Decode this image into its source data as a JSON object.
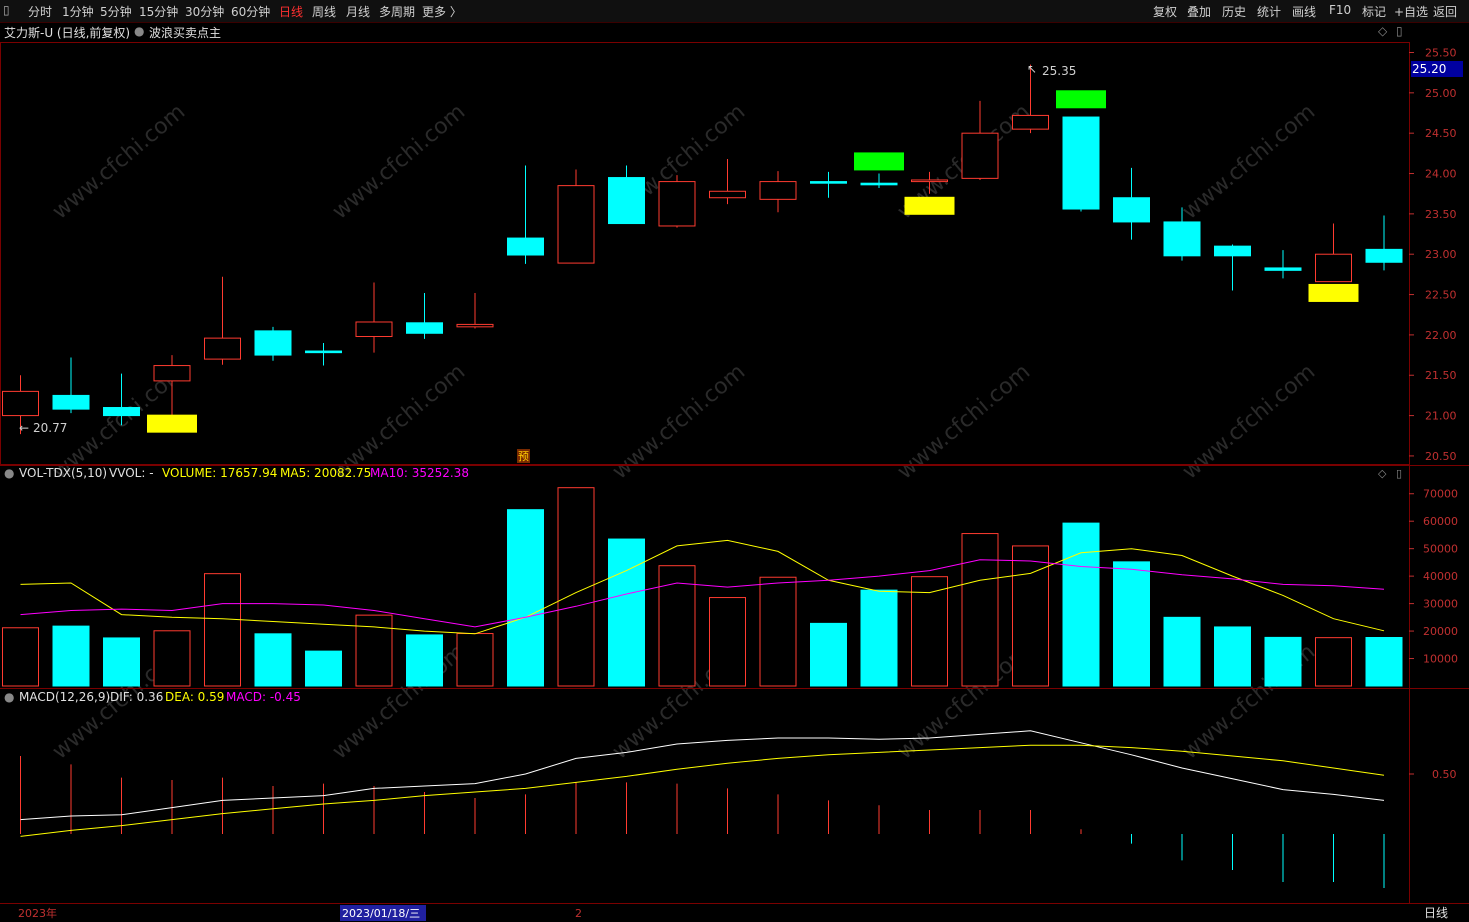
{
  "toolbar": {
    "left": [
      "分时",
      "1分钟",
      "5分钟",
      "15分钟",
      "30分钟",
      "60分钟",
      "日线",
      "周线",
      "月线",
      "多周期",
      "更多 〉"
    ],
    "active": "日线",
    "right": [
      "复权",
      "叠加",
      "历史",
      "统计",
      "画线",
      "F10",
      "标记",
      "+自选",
      "返回"
    ]
  },
  "chart_title": {
    "stock": "艾力斯-U (日线,前复权)",
    "indicator": "波浪买卖点主"
  },
  "price_panel": {
    "current_price": "25.20",
    "high_label": "25.35",
    "low_label": "20.77",
    "pre_marker": "预",
    "y_ticks": [
      "25.50",
      "25.00",
      "24.50",
      "24.00",
      "23.50",
      "23.00",
      "22.50",
      "22.00",
      "21.50",
      "21.00",
      "20.50"
    ]
  },
  "volume_panel": {
    "title": "VOL-TDX(5,10)",
    "vvol": "VVOL: -",
    "volume": "VOLUME: 17657.94",
    "ma5": "MA5: 20082.75",
    "ma10": "MA10: 35252.38",
    "y_ticks": [
      "70000",
      "60000",
      "50000",
      "40000",
      "30000",
      "20000",
      "10000"
    ]
  },
  "macd_panel": {
    "title": "MACD(12,26,9)",
    "dif": "DIF: 0.36",
    "dea": "DEA: 0.59",
    "macd": "MACD: -0.45",
    "y_tick": "0.50"
  },
  "bottom": {
    "year": "2023年",
    "date": "2023/01/18/三",
    "month": "2",
    "period": "日线"
  },
  "colors": {
    "up": "#ff3b30",
    "down": "#00ffff",
    "ma5": "#ffff00",
    "ma10": "#ff00ff",
    "buy": "#ffff00",
    "sell": "#00ff00"
  },
  "chart_data": {
    "type": "candlestick",
    "candles": [
      {
        "o": 21.0,
        "h": 21.5,
        "l": 20.77,
        "c": 21.3
      },
      {
        "o": 21.25,
        "h": 21.72,
        "l": 21.03,
        "c": 21.08
      },
      {
        "o": 21.1,
        "h": 21.52,
        "l": 20.88,
        "c": 21.0
      },
      {
        "o": 21.43,
        "h": 21.75,
        "l": 20.8,
        "c": 21.62
      },
      {
        "o": 21.7,
        "h": 22.72,
        "l": 21.63,
        "c": 21.96
      },
      {
        "o": 22.05,
        "h": 22.1,
        "l": 21.68,
        "c": 21.75
      },
      {
        "o": 21.8,
        "h": 21.9,
        "l": 21.62,
        "c": 21.78
      },
      {
        "o": 21.98,
        "h": 22.65,
        "l": 21.78,
        "c": 22.16
      },
      {
        "o": 22.15,
        "h": 22.52,
        "l": 21.95,
        "c": 22.02
      },
      {
        "o": 22.1,
        "h": 22.52,
        "l": 22.08,
        "c": 22.13
      },
      {
        "o": 23.2,
        "h": 24.1,
        "l": 22.88,
        "c": 22.99
      },
      {
        "o": 22.89,
        "h": 24.05,
        "l": 22.89,
        "c": 23.85
      },
      {
        "o": 23.95,
        "h": 24.1,
        "l": 23.38,
        "c": 23.38
      },
      {
        "o": 23.35,
        "h": 23.98,
        "l": 23.33,
        "c": 23.9
      },
      {
        "o": 23.7,
        "h": 24.18,
        "l": 23.62,
        "c": 23.78
      },
      {
        "o": 23.68,
        "h": 24.03,
        "l": 23.52,
        "c": 23.9
      },
      {
        "o": 23.9,
        "h": 24.02,
        "l": 23.7,
        "c": 23.88
      },
      {
        "o": 23.88,
        "h": 24.0,
        "l": 23.82,
        "c": 23.86
      },
      {
        "o": 23.9,
        "h": 24.02,
        "l": 23.75,
        "c": 23.92
      },
      {
        "o": 23.94,
        "h": 24.9,
        "l": 23.92,
        "c": 24.5
      },
      {
        "o": 24.55,
        "h": 25.35,
        "l": 24.5,
        "c": 24.72
      },
      {
        "o": 24.7,
        "h": 24.7,
        "l": 23.53,
        "c": 23.56
      },
      {
        "o": 23.7,
        "h": 24.07,
        "l": 23.18,
        "c": 23.4
      },
      {
        "o": 23.4,
        "h": 23.58,
        "l": 22.92,
        "c": 22.98
      },
      {
        "o": 23.1,
        "h": 23.12,
        "l": 22.55,
        "c": 22.98
      },
      {
        "o": 22.83,
        "h": 23.05,
        "l": 22.7,
        "c": 22.8
      },
      {
        "o": 22.66,
        "h": 23.38,
        "l": 22.66,
        "c": 23.0
      },
      {
        "o": 23.06,
        "h": 23.48,
        "l": 22.8,
        "c": 22.9
      }
    ],
    "volume": [
      21200,
      21800,
      17500,
      20100,
      40900,
      19000,
      12700,
      25800,
      18600,
      19100,
      64200,
      72200,
      53500,
      43800,
      32200,
      39600,
      22800,
      34900,
      39800,
      55500,
      51000,
      59300,
      45200,
      25000,
      21500,
      17700,
      17600,
      17658
    ],
    "vol_ma5": [
      37000,
      37500,
      26000,
      25000,
      24500,
      23500,
      22500,
      21500,
      20000,
      19000,
      25000,
      34000,
      42000,
      51000,
      53000,
      49000,
      38500,
      34500,
      34000,
      38500,
      41000,
      48500,
      50000,
      47500,
      40000,
      33000,
      24500,
      20083
    ],
    "vol_ma10": [
      26000,
      27500,
      28000,
      27500,
      30000,
      30000,
      29500,
      27500,
      24500,
      21500,
      25000,
      29000,
      33500,
      37500,
      36000,
      37500,
      38500,
      40000,
      42000,
      46000,
      45500,
      43500,
      42500,
      40500,
      39000,
      37000,
      36500,
      35252
    ],
    "dif": [
      0.12,
      0.15,
      0.16,
      0.22,
      0.28,
      0.3,
      0.32,
      0.38,
      0.4,
      0.42,
      0.5,
      0.63,
      0.68,
      0.75,
      0.78,
      0.8,
      0.8,
      0.79,
      0.8,
      0.83,
      0.86,
      0.76,
      0.66,
      0.55,
      0.46,
      0.37,
      0.33,
      0.28
    ],
    "dea": [
      -0.02,
      0.03,
      0.07,
      0.12,
      0.17,
      0.21,
      0.25,
      0.28,
      0.32,
      0.35,
      0.38,
      0.43,
      0.48,
      0.54,
      0.59,
      0.63,
      0.66,
      0.68,
      0.7,
      0.72,
      0.74,
      0.74,
      0.72,
      0.69,
      0.65,
      0.61,
      0.55,
      0.49
    ],
    "macd": [
      0.65,
      0.58,
      0.47,
      0.45,
      0.47,
      0.4,
      0.42,
      0.4,
      0.35,
      0.3,
      0.33,
      0.43,
      0.43,
      0.42,
      0.38,
      0.33,
      0.28,
      0.24,
      0.2,
      0.2,
      0.2,
      0.04,
      -0.08,
      -0.22,
      -0.3,
      -0.4,
      -0.4,
      -0.45
    ],
    "signals": [
      {
        "index": 3,
        "type": "buy",
        "value": 20.9
      },
      {
        "index": 17,
        "type": "sell",
        "value": 24.15
      },
      {
        "index": 18,
        "type": "buy",
        "value": 23.6
      },
      {
        "index": 21,
        "type": "sell",
        "value": 24.92
      },
      {
        "index": 26,
        "type": "buy",
        "value": 22.52
      }
    ],
    "price_range": [
      20.4,
      25.63
    ],
    "volume_range": [
      0,
      75000
    ],
    "macd_range": [
      -0.55,
      1.05
    ]
  }
}
